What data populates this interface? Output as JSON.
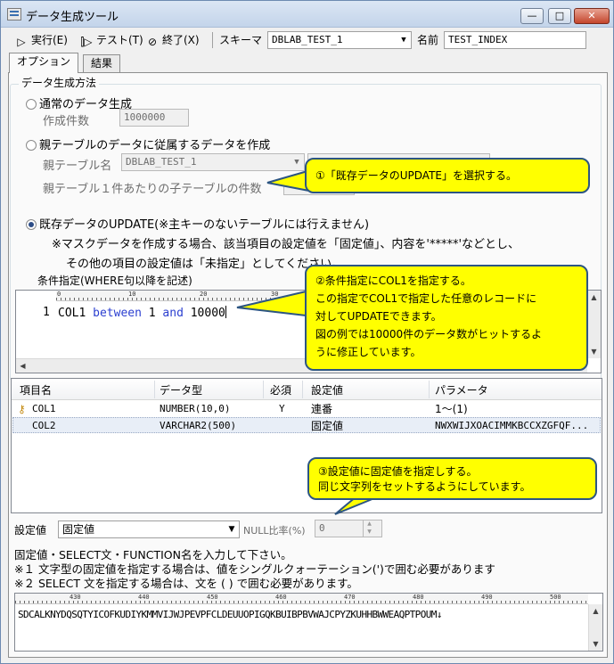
{
  "window": {
    "title": "データ生成ツール",
    "buttons": {
      "minimize": "—",
      "maximize": "□",
      "close": "✕"
    }
  },
  "toolbar": {
    "run_label": "実行(E)",
    "test_label": "テスト(T)",
    "exit_label": "終了(X)",
    "schema_label": "スキーマ",
    "schema_value": "DBLAB_TEST_1",
    "name_label": "名前",
    "name_value": "TEST_INDEX"
  },
  "tabs": [
    {
      "label": "オプション",
      "active": true
    },
    {
      "label": "結果",
      "active": false
    }
  ],
  "generation": {
    "group_title": "データ生成方法",
    "normal": {
      "label": "通常のデータ生成",
      "count_label": "作成件数",
      "count_value": "1000000"
    },
    "parent": {
      "label": "親テーブルのデータに従属するデータを作成",
      "table_label": "親テーブル名",
      "table_value": "DBLAB_TEST_1",
      "child_count_label": "親テーブル１件あたりの子テーブルの件数"
    },
    "update": {
      "label": "既存データのUPDATE(※主キーのないテーブルには行えません)",
      "note_line1": "※マスクデータを作成する場合、該当項目の設定値を「固定値」、内容を'*****'などとし、",
      "note_line2": "その他の項目の設定値は「未指定」としてください。",
      "selected": true
    },
    "where_label": "条件指定(WHERE句以降を記述)"
  },
  "where_editor": {
    "ruler_ticks": [
      "0",
      "10",
      "20",
      "30"
    ],
    "line_number": "1",
    "code_tokens": [
      {
        "text": "COL1 ",
        "kind": "plain"
      },
      {
        "text": "between",
        "kind": "keyword"
      },
      {
        "text": " 1 ",
        "kind": "plain"
      },
      {
        "text": "and",
        "kind": "keyword"
      },
      {
        "text": " 10000",
        "kind": "plain"
      }
    ]
  },
  "columns_table": {
    "headers": [
      "項目名",
      "データ型",
      "必須",
      "設定値",
      "パラメータ"
    ],
    "rows": [
      {
        "name": "COL1",
        "type": "NUMBER(10,0)",
        "required": "Y",
        "setting": "連番",
        "param": "1～(1)",
        "key": true
      },
      {
        "name": "COL2",
        "type": "VARCHAR2(500)",
        "required": "",
        "setting": "固定値",
        "param": "NWXWIJXOACIMMKBCCXZGFQF...",
        "key": false
      }
    ]
  },
  "setting": {
    "label": "設定値",
    "value": "固定値",
    "null_ratio_label": "NULL比率(%)",
    "null_ratio_value": "0"
  },
  "help": {
    "line1": "固定値・SELECT文・FUNCTION名を入力して下さい。",
    "line2": "※１ 文字型の固定値を指定する場合は、値をシングルクォーテーション(')で囲む必要があります",
    "line3": "※２ SELECT 文を指定する場合は、文を ( ) で囲む必要があります。"
  },
  "value_editor": {
    "ruler_ticks": [
      "430",
      "440",
      "450",
      "460",
      "470",
      "480",
      "490",
      "500"
    ],
    "text": "SDCALKNYDQSQTYICOFKUDIYKMMVIJWJPEVPFCLDEUUOPIGQKBUIBPBVWAJCPYZKUHHBWWEAQPTPOUM↓"
  },
  "callouts": {
    "c1": "①「既存データのUPDATE」を選択する。",
    "c2_line1": "②条件指定にCOL1を指定する。",
    "c2_line2": "この指定でCOL1で指定した任意のレコードに",
    "c2_line3": "対してUPDATEできます。",
    "c2_line4": "図の例では10000件のデータ数がヒットするよ",
    "c2_line5": "うに修正しています。",
    "c3_line1": "③設定値に固定値を指定しする。",
    "c3_line2": "同じ文字列をセットするようにしています。"
  },
  "colors": {
    "callout_fill": "#ffff00",
    "callout_border": "#2c5582",
    "keyword": "#2b3fd0",
    "selected_row": "#e8eef7"
  }
}
